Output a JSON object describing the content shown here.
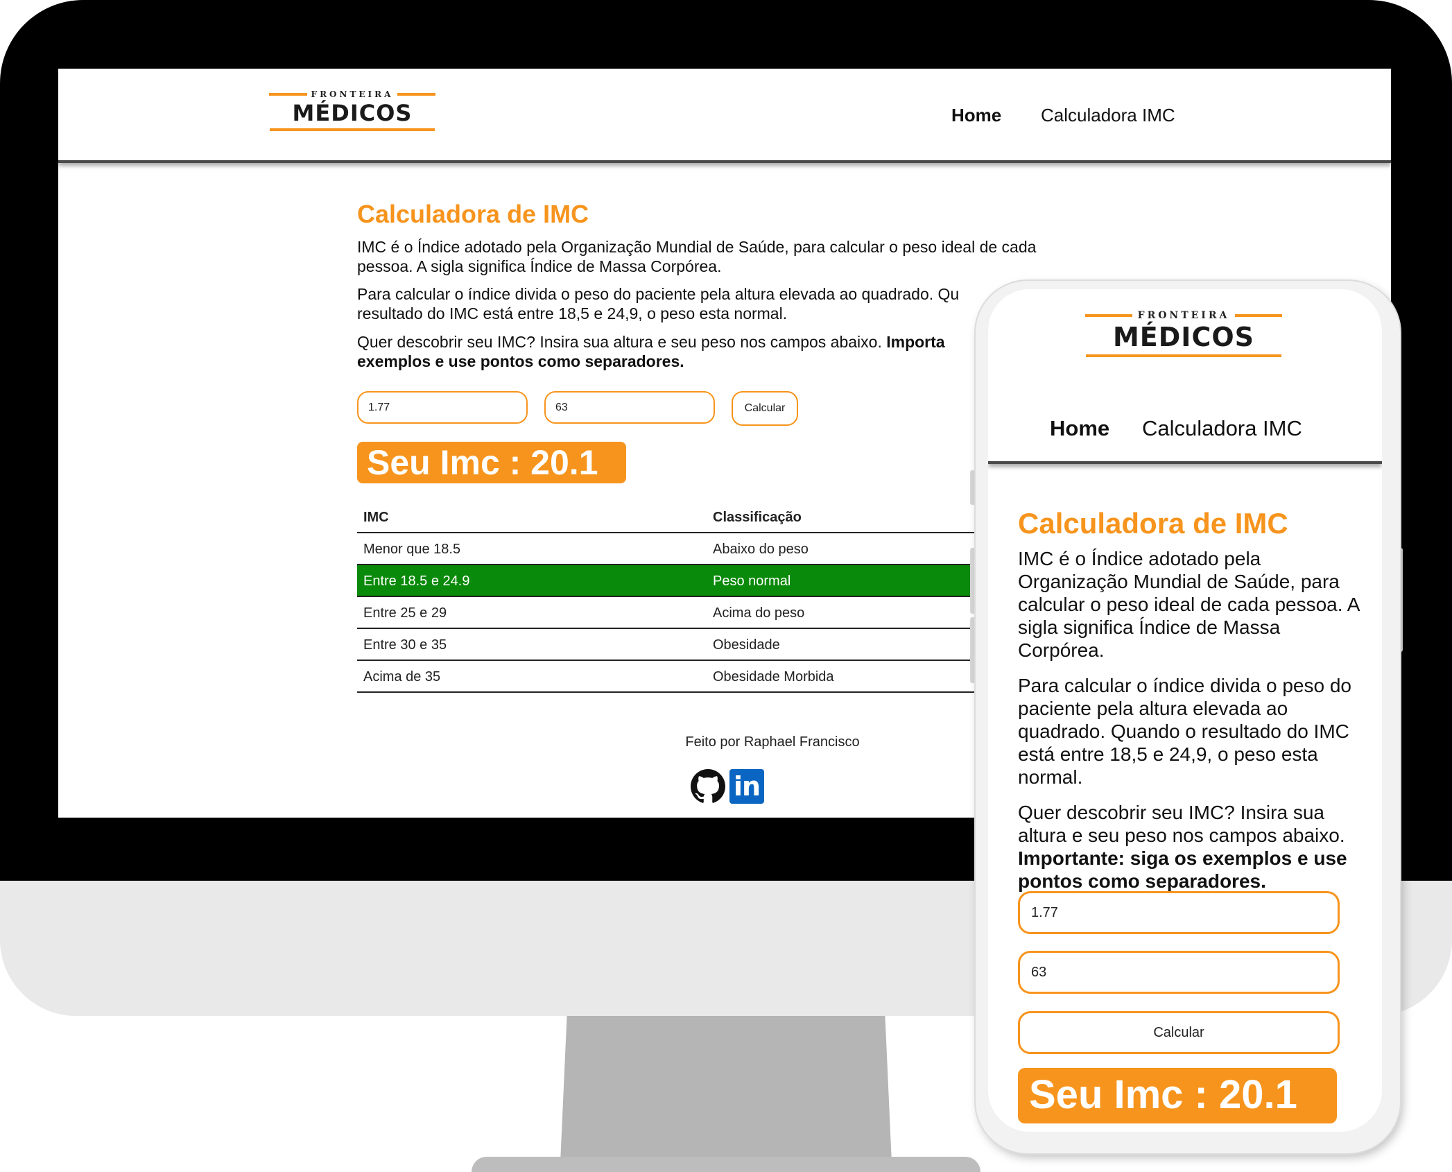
{
  "brand": {
    "top_word": "FRONTEIRA",
    "main_word": "MÉDICOS"
  },
  "nav": {
    "home": "Home",
    "calculator": "Calculadora IMC"
  },
  "page": {
    "title": "Calculadora de IMC",
    "intro": "IMC é o Índice adotado pela Organização Mundial de Saúde, para calcular o peso ideal de cada pessoa. A sigla significa Índice de Massa Corpórea.",
    "how_to": "Para calcular o índice divida o peso do paciente pela altura elevada ao quadrado. Quando o resultado do IMC está entre 18,5 e 24,9, o peso esta normal.",
    "prompt": "Quer descobrir seu IMC? Insira sua altura e seu peso nos campos abaixo.",
    "important": "Importante: siga os exemplos e use pontos como separadores."
  },
  "desktop_text": {
    "intro_line1": "IMC é o Índice adotado pela Organização Mundial de Saúde, para calcular o peso ideal de cada",
    "intro_line2": "pessoa. A sigla significa Índice de Massa Corpórea.",
    "how_to_line1": "Para calcular o índice divida o peso do paciente pela altura elevada ao quadrado. Qu",
    "how_to_line2": "resultado do IMC está entre 18,5 e 24,9, o peso esta normal.",
    "prompt_line1": "Quer descobrir seu IMC? Insira sua altura e seu peso nos campos abaixo.",
    "important_line1": "Importa",
    "important_line2": "exemplos e use pontos como separadores."
  },
  "form": {
    "height_value": "1.77",
    "weight_value": "63",
    "submit_label": "Calcular"
  },
  "result": {
    "text": "Seu Imc : 20.1"
  },
  "table": {
    "headers": [
      "IMC",
      "Classificação"
    ],
    "rows": [
      {
        "imc": "Menor que 18.5",
        "class": "Abaixo do peso"
      },
      {
        "imc": "Entre 18.5 e 24.9",
        "class": "Peso normal"
      },
      {
        "imc": "Entre 25 e 29",
        "class": "Acima do peso"
      },
      {
        "imc": "Entre 30 e 35",
        "class": "Obesidade"
      },
      {
        "imc": "Acima de 35",
        "class": "Obesidade Morbida"
      }
    ],
    "highlighted_row": 1,
    "highlight_color": "#0a8a0a"
  },
  "footer": {
    "credit": "Feito por Raphael Francisco",
    "icons": [
      "github-icon",
      "linkedin-icon"
    ],
    "linkedin_text": "in"
  },
  "colors": {
    "accent": "#f7941d",
    "highlight": "#0a8a0a",
    "linkedin": "#0a66c2"
  }
}
